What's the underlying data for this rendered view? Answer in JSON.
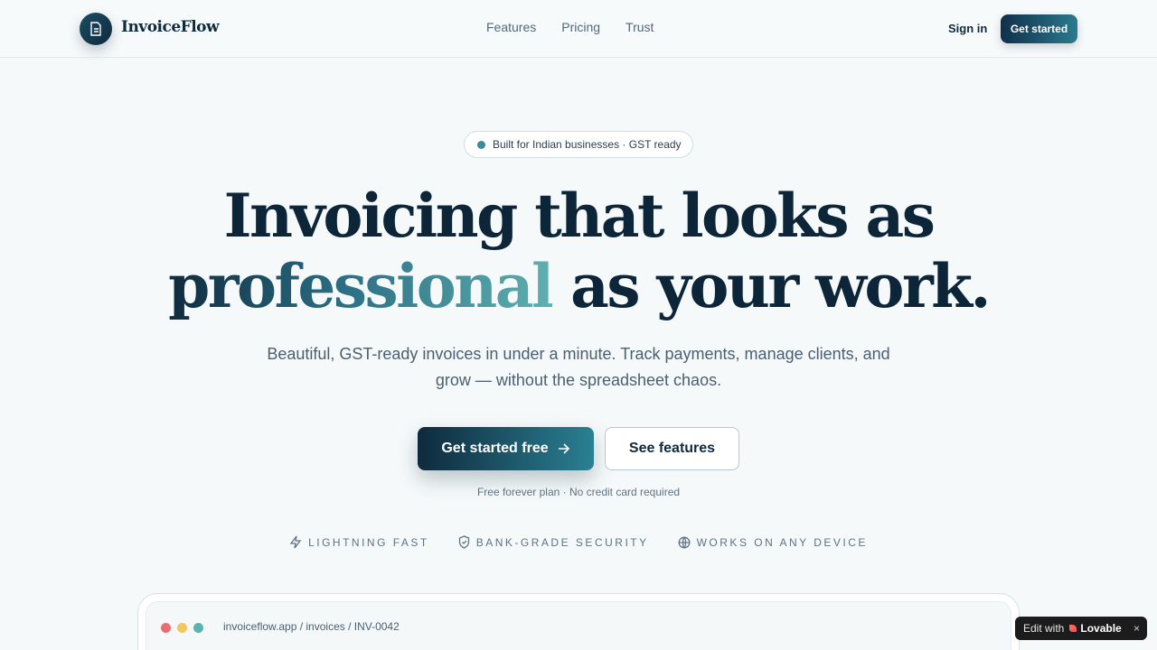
{
  "nav": {
    "brand": "InvoiceFlow",
    "links": [
      "Features",
      "Pricing",
      "Trust"
    ],
    "signin": "Sign in",
    "cta": "Get started"
  },
  "hero": {
    "badge": "Built for Indian businesses · GST ready",
    "headline_line1": "Invoicing that looks as",
    "headline_highlight": "professional",
    "headline_line2_rest": " as your work.",
    "subtitle": "Beautiful, GST-ready invoices in under a minute. Track payments, manage clients, and grow — without the spreadsheet chaos.",
    "cta_primary": "Get started free",
    "cta_secondary": "See features",
    "note": "Free forever plan · No credit card required"
  },
  "features": [
    {
      "label": "LIGHTNING FAST",
      "icon": "lightning-icon"
    },
    {
      "label": "BANK-GRADE SECURITY",
      "icon": "shield-icon"
    },
    {
      "label": "WORKS ON ANY DEVICE",
      "icon": "globe-icon"
    }
  ],
  "mockup": {
    "url": "invoiceflow.app / invoices / INV-0042",
    "dots": [
      "#ef6b73",
      "#f5c65a",
      "#5ab3b0"
    ]
  },
  "lovable": {
    "prefix": "Edit with",
    "brand": "Lovable",
    "close": "×"
  },
  "colors": {
    "accent": "#0f2a3d",
    "teal": "#2a8092",
    "background": "#f5f9fa"
  }
}
